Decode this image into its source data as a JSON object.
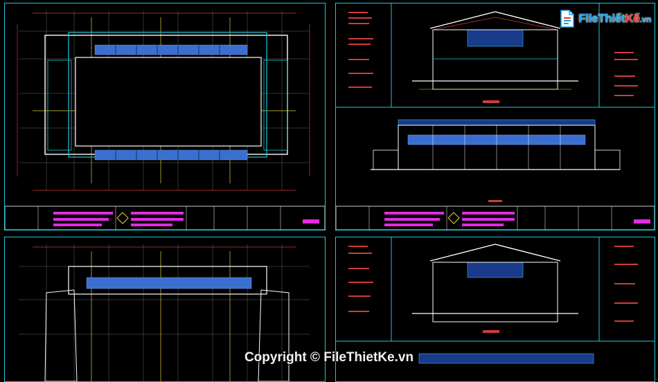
{
  "watermark": {
    "brand_main": "FileThiết",
    "brand_accent": "Kế",
    "brand_suffix": ".vn",
    "copyright": "Copyright © FileThietKe.vn"
  },
  "colors": {
    "frame": "#21c8d8",
    "grid_red": "#d23b3b",
    "grid_yellow": "#e6d23a",
    "wall_white": "#ffffff",
    "seat_blue": "#3a6fd0",
    "magenta": "#e02ce0",
    "green": "#27c24c"
  },
  "icons": {
    "logo": "filethietke-logo-icon",
    "copyright": "copyright-text"
  }
}
